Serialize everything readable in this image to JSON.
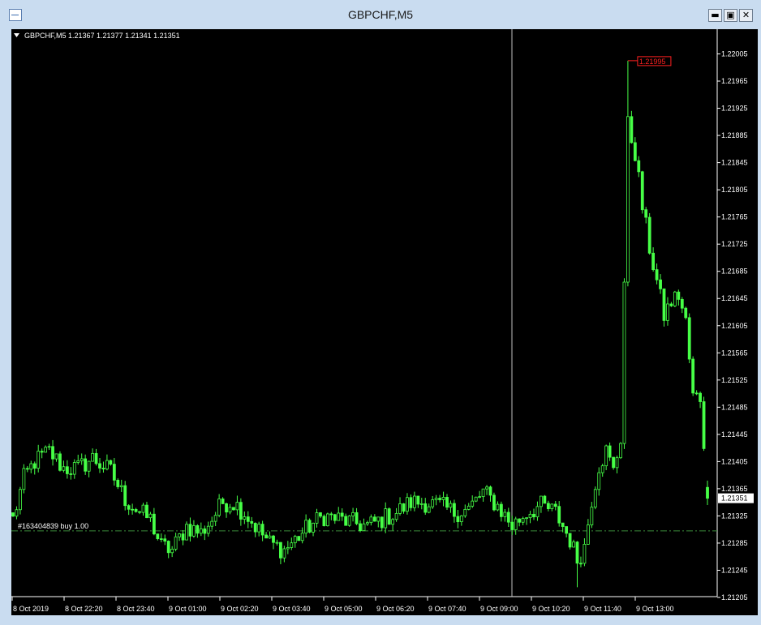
{
  "window": {
    "title": "GBPCHF,M5",
    "buttons": {
      "minimize": "▬",
      "maximize": "▣",
      "close": "✕"
    }
  },
  "colors": {
    "background": "#000000",
    "candle": "#46ff46",
    "axis_text": "#ffffff",
    "order_line": "#3a8a3a",
    "max_label": "#ff2020",
    "crosshair": "#c0c0c0"
  },
  "chart_data": {
    "type": "candlestick",
    "symbol": "GBPCHF",
    "timeframe": "M5",
    "header": "GBPCHF,M5  1.21367 1.21377 1.21341 1.21351",
    "ohlc_last": {
      "open": 1.21367,
      "high": 1.21377,
      "low": 1.21341,
      "close": 1.21351
    },
    "ylim": [
      1.21205,
      1.22025
    ],
    "y_ticks": [
      "1.22005",
      "1.21965",
      "1.21925",
      "1.21885",
      "1.21845",
      "1.21805",
      "1.21765",
      "1.21725",
      "1.21685",
      "1.21645",
      "1.21605",
      "1.21565",
      "1.21525",
      "1.21485",
      "1.21445",
      "1.21405",
      "1.21365",
      "1.21325",
      "1.21285",
      "1.21245",
      "1.21205"
    ],
    "x_ticks": [
      "8 Oct 2019",
      "8 Oct 22:20",
      "8 Oct 23:40",
      "9 Oct 01:00",
      "9 Oct 02:20",
      "9 Oct 03:40",
      "9 Oct 05:00",
      "9 Oct 06:20",
      "9 Oct 07:40",
      "9 Oct 09:00",
      "9 Oct 10:20",
      "9 Oct 11:40",
      "9 Oct 13:00"
    ],
    "bar_count": 193,
    "current_price": "1.21351",
    "max_price_label": "1.21995",
    "order": {
      "label": "#163404839 buy 1.00",
      "price": 1.21303
    },
    "grid": false,
    "anchors": [
      [
        0,
        1.2132
      ],
      [
        3,
        1.2138
      ],
      [
        6,
        1.21405
      ],
      [
        10,
        1.2142
      ],
      [
        14,
        1.21395
      ],
      [
        18,
        1.21395
      ],
      [
        22,
        1.2141
      ],
      [
        27,
        1.2139
      ],
      [
        31,
        1.2135
      ],
      [
        35,
        1.2133
      ],
      [
        38,
        1.2132
      ],
      [
        41,
        1.2128
      ],
      [
        44,
        1.21275
      ],
      [
        48,
        1.2131
      ],
      [
        52,
        1.213
      ],
      [
        55,
        1.2132
      ],
      [
        58,
        1.21345
      ],
      [
        61,
        1.21345
      ],
      [
        64,
        1.2133
      ],
      [
        67,
        1.2131
      ],
      [
        71,
        1.21285
      ],
      [
        75,
        1.21275
      ],
      [
        78,
        1.2129
      ],
      [
        82,
        1.2131
      ],
      [
        86,
        1.21325
      ],
      [
        90,
        1.2132
      ],
      [
        94,
        1.21315
      ],
      [
        98,
        1.2131
      ],
      [
        102,
        1.2132
      ],
      [
        106,
        1.2133
      ],
      [
        110,
        1.21345
      ],
      [
        114,
        1.21345
      ],
      [
        118,
        1.2134
      ],
      [
        122,
        1.2133
      ],
      [
        126,
        1.21335
      ],
      [
        130,
        1.2136
      ],
      [
        134,
        1.2134
      ],
      [
        138,
        1.2131
      ],
      [
        142,
        1.2133
      ],
      [
        146,
        1.2134
      ],
      [
        150,
        1.2133
      ],
      [
        152,
        1.2131
      ],
      [
        154,
        1.2129
      ],
      [
        156,
        1.2126
      ],
      [
        158,
        1.2128
      ],
      [
        160,
        1.2135
      ],
      [
        162,
        1.214
      ],
      [
        164,
        1.2142
      ],
      [
        166,
        1.2139
      ],
      [
        168,
        1.2144
      ],
      [
        170,
        1.219
      ],
      [
        172,
        1.2186
      ],
      [
        174,
        1.2178
      ],
      [
        176,
        1.2172
      ],
      [
        178,
        1.2167
      ],
      [
        180,
        1.2162
      ],
      [
        182,
        1.2164
      ],
      [
        184,
        1.2165
      ],
      [
        186,
        1.2161
      ],
      [
        188,
        1.215
      ],
      [
        190,
        1.215
      ],
      [
        192,
        1.2137
      ],
      [
        193,
        1.21351
      ]
    ],
    "highlights": {
      "peak_bar": 170,
      "peak_high": 1.21995,
      "low_bar": 156,
      "low_low": 1.2122
    }
  }
}
